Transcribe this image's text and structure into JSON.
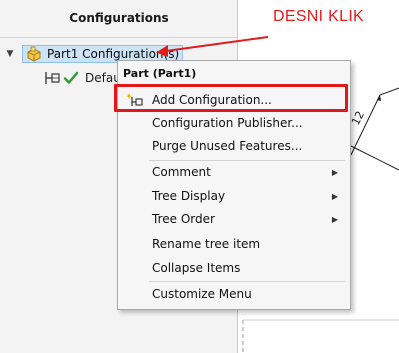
{
  "panel": {
    "title": "Configurations",
    "tree_root_label": "Part1 Configuration(s)",
    "tree_child_label": "Default"
  },
  "annotation": {
    "text": "DESNI KLIK",
    "color": "#e11c1c"
  },
  "context_menu": {
    "header": "Part (Part1)",
    "items": [
      {
        "label": "Add Configuration...",
        "icon": "add-configuration-icon",
        "submenu": false,
        "highlighted": true
      },
      {
        "label": "Configuration Publisher...",
        "icon": "",
        "submenu": false,
        "highlighted": false
      },
      {
        "label": "Purge Unused Features...",
        "icon": "",
        "submenu": false,
        "highlighted": false
      },
      {
        "label": "Comment",
        "icon": "",
        "submenu": true,
        "highlighted": false
      },
      {
        "label": "Tree Display",
        "icon": "",
        "submenu": true,
        "highlighted": false
      },
      {
        "label": "Tree Order",
        "icon": "",
        "submenu": true,
        "highlighted": false
      },
      {
        "label": "Rename tree item",
        "icon": "",
        "submenu": false,
        "highlighted": false
      },
      {
        "label": "Collapse Items",
        "icon": "",
        "submenu": false,
        "highlighted": false
      },
      {
        "label": "Customize Menu",
        "icon": "",
        "submenu": false,
        "highlighted": false
      }
    ]
  },
  "drawing": {
    "dimension_label": "12"
  },
  "colors": {
    "highlight_red": "#e01818",
    "selection_blue": "#cde4f7",
    "panel_bg": "#f3f3f3",
    "menu_bg": "#f6f6f6"
  }
}
